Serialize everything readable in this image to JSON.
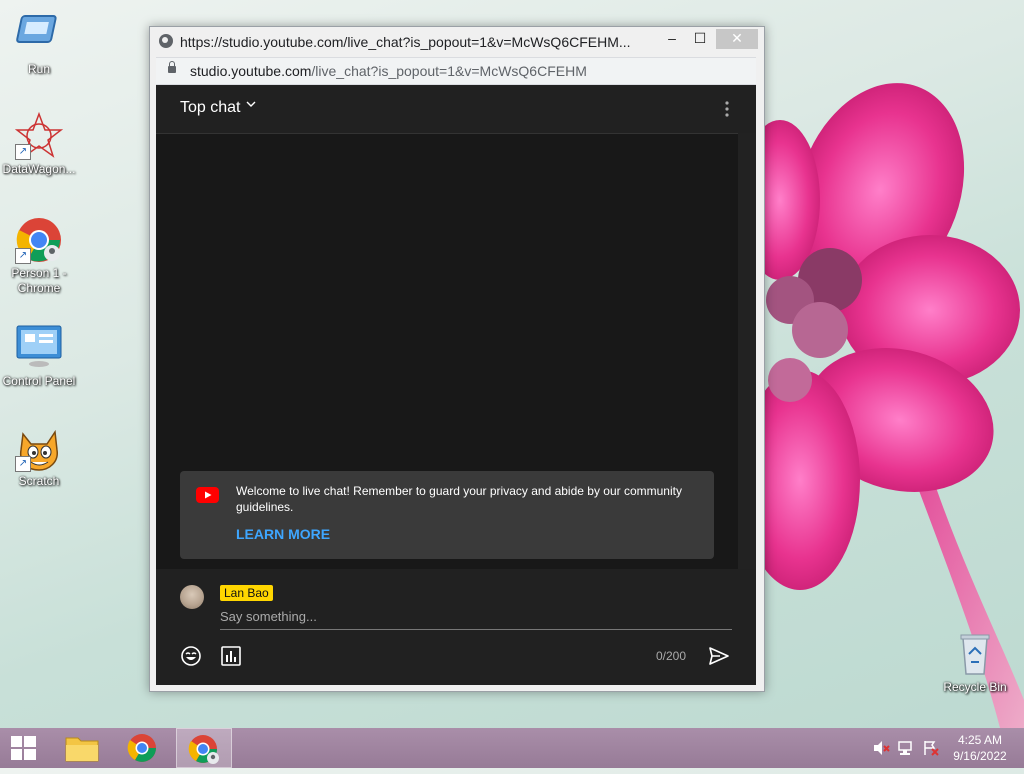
{
  "desktop": {
    "icons": [
      {
        "label": "Run"
      },
      {
        "label": "DataWagon..."
      },
      {
        "label": "Person 1 - Chrome"
      },
      {
        "label": "Control Panel"
      },
      {
        "label": "Scratch"
      },
      {
        "label": "Recycle Bin"
      }
    ]
  },
  "window": {
    "title": "https://studio.youtube.com/live_chat?is_popout=1&v=McWsQ6CFEHM...",
    "address_host": "studio.youtube.com",
    "address_path": "/live_chat?is_popout=1&v=McWsQ6CFEHM",
    "controls": {
      "minimize": "–",
      "maximize": "☐",
      "close": "✕"
    }
  },
  "chat": {
    "header_title": "Top chat",
    "welcome_text": "Welcome to live chat! Remember to guard your privacy and abide by our community guidelines.",
    "learn_more": "LEARN MORE",
    "author_name": "Lan Bao",
    "input_placeholder": "Say something...",
    "char_counter": "0/200"
  },
  "taskbar": {
    "clock_time": "4:25 AM",
    "clock_date": "9/16/2022"
  },
  "colors": {
    "chat_bg": "#181818",
    "accent_link": "#3ea6ff",
    "author_badge": "#ffd600",
    "youtube_red": "#ff0000"
  }
}
